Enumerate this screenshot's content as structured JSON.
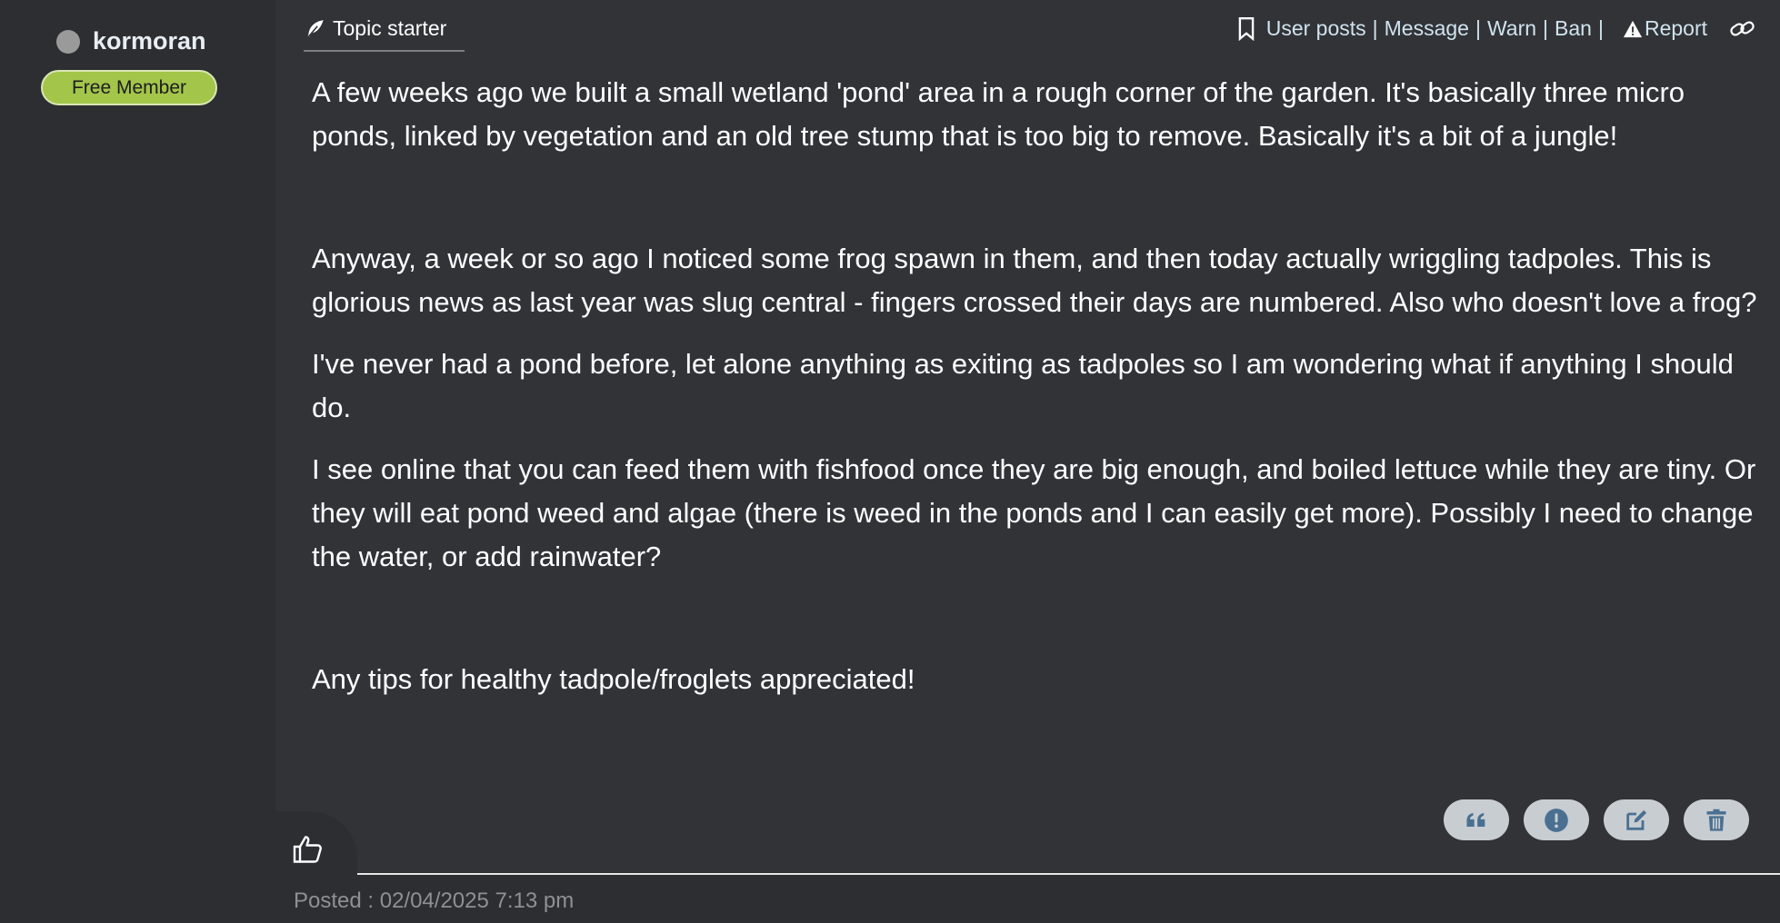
{
  "author": {
    "name": "kormoran",
    "badge": "Free Member",
    "status_color": "#9a9a9a"
  },
  "post": {
    "topic_starter_label": "Topic starter",
    "actions": {
      "user_posts": "User posts",
      "message": "Message",
      "warn": "Warn",
      "ban": "Ban",
      "report": "Report",
      "separator": "|"
    },
    "paragraphs": [
      "A few weeks ago we built a small wetland 'pond' area in a rough corner of the garden. It's basically three micro ponds, linked by vegetation and an old tree stump that is too big to remove. Basically it's a bit of a jungle!",
      "Anyway, a week or so ago I noticed some frog spawn in them, and then today actually wriggling tadpoles. This is glorious news as last year was slug central - fingers crossed their days are numbered. Also who doesn't love a frog?",
      "I've never had a pond before, let alone anything as exiting as tadpoles so I am wondering what if anything I should do.",
      "I see online that you can feed them with fishfood once they are big enough, and boiled lettuce while they are tiny. Or they will eat pond weed and algae (there is weed in the ponds and I can easily get more). Possibly I need to change the water, or add rainwater?",
      "Any tips for healthy tadpole/froglets appreciated!"
    ],
    "posted": "Posted : 02/04/2025 7:13 pm"
  },
  "icons": {
    "topic_starter": "feather-icon",
    "bookmark": "bookmark-icon",
    "report": "warning-triangle-icon",
    "permalink": "link-icon",
    "quote": "quote-icon",
    "flag": "exclamation-circle-icon",
    "edit": "edit-icon",
    "delete": "trash-icon",
    "like": "thumbs-up-icon"
  },
  "colors": {
    "badge_bg": "#a3c54a",
    "action_link": "#cfe3ef",
    "post_bg": "#323337",
    "sidebar_bg": "#2d2e31",
    "button_bg": "#c8cdd2",
    "button_icon": "#4a7091"
  }
}
